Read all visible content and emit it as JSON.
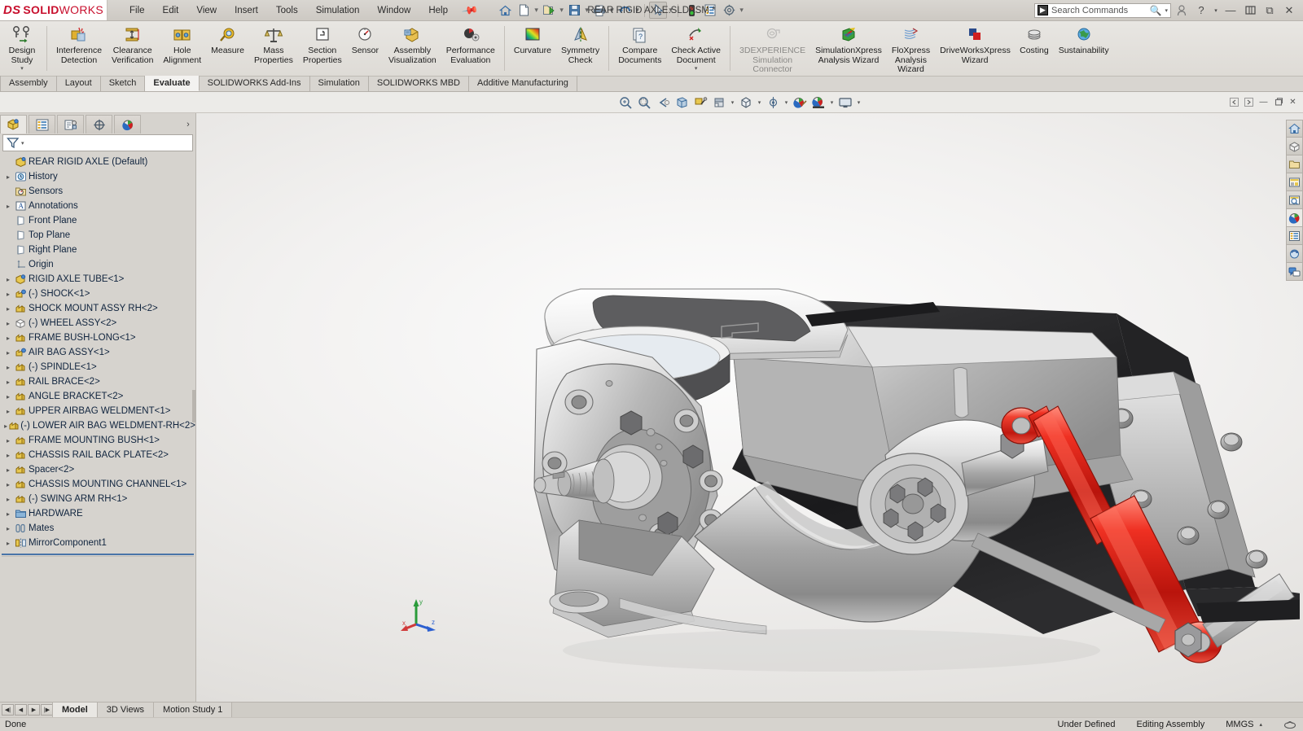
{
  "app": {
    "brand_ds": "DS",
    "brand_solid": "SOLID",
    "brand_works": "WORKS",
    "document_title": "REAR RIGID AXLE.SLDASM *"
  },
  "menubar": {
    "items": [
      {
        "label": "File"
      },
      {
        "label": "Edit"
      },
      {
        "label": "View"
      },
      {
        "label": "Insert"
      },
      {
        "label": "Tools"
      },
      {
        "label": "Simulation"
      },
      {
        "label": "Window"
      },
      {
        "label": "Help"
      }
    ],
    "pin_icon": "pushpin-icon"
  },
  "quick_access": {
    "buttons": [
      {
        "name": "home-icon",
        "glyph": "⌂"
      },
      {
        "name": "new-document-icon",
        "glyph": "□"
      },
      {
        "name": "open-document-icon",
        "glyph": "▶"
      },
      {
        "name": "save-icon",
        "glyph": "▤"
      },
      {
        "name": "print-icon",
        "glyph": "⎙"
      },
      {
        "name": "undo-icon",
        "glyph": "↶"
      },
      {
        "name": "select-cursor-icon",
        "glyph": "➤"
      },
      {
        "name": "rebuild-traffic-light-icon",
        "glyph": "●"
      },
      {
        "name": "options-list-icon",
        "glyph": "☰"
      },
      {
        "name": "settings-gear-icon",
        "glyph": "⚙"
      }
    ]
  },
  "search": {
    "placeholder": "Search Commands",
    "logo_glyph": "▶",
    "magnifier_icon": "search-icon"
  },
  "window_controls": {
    "account_icon": "user-account-icon",
    "help_icon": "help-question-icon",
    "minimize": "—",
    "restore": "⧉",
    "close": "✕"
  },
  "ribbon": {
    "groups": [
      {
        "buttons": [
          {
            "label": "Design\nStudy",
            "name": "design-study-button",
            "icon": "design-study-icon",
            "caret": true,
            "disabled": false
          }
        ]
      },
      {
        "buttons": [
          {
            "label": "Interference\nDetection",
            "name": "interference-detection-button",
            "icon": "interference-detection-icon",
            "caret": false,
            "disabled": false
          },
          {
            "label": "Clearance\nVerification",
            "name": "clearance-verification-button",
            "icon": "clearance-verification-icon",
            "caret": false,
            "disabled": false
          },
          {
            "label": "Hole\nAlignment",
            "name": "hole-alignment-button",
            "icon": "hole-alignment-icon",
            "caret": false,
            "disabled": false
          },
          {
            "label": "Measure",
            "name": "measure-button",
            "icon": "measure-tape-icon",
            "caret": false,
            "disabled": false
          },
          {
            "label": "Mass\nProperties",
            "name": "mass-properties-button",
            "icon": "mass-properties-scale-icon",
            "caret": false,
            "disabled": false
          },
          {
            "label": "Section\nProperties",
            "name": "section-properties-button",
            "icon": "section-properties-icon",
            "caret": false,
            "disabled": false
          },
          {
            "label": "Sensor",
            "name": "sensor-button",
            "icon": "sensor-gauge-icon",
            "caret": false,
            "disabled": false
          },
          {
            "label": "Assembly\nVisualization",
            "name": "assembly-visualization-button",
            "icon": "assembly-visualization-icon",
            "caret": false,
            "disabled": false
          },
          {
            "label": "Performance\nEvaluation",
            "name": "performance-evaluation-button",
            "icon": "performance-evaluation-icon",
            "caret": false,
            "disabled": false
          }
        ]
      },
      {
        "buttons": [
          {
            "label": "Curvature",
            "name": "curvature-button",
            "icon": "curvature-rainbow-icon",
            "caret": false,
            "disabled": false
          },
          {
            "label": "Symmetry\nCheck",
            "name": "symmetry-check-button",
            "icon": "symmetry-check-icon",
            "caret": false,
            "disabled": false
          }
        ]
      },
      {
        "buttons": [
          {
            "label": "Compare\nDocuments",
            "name": "compare-documents-button",
            "icon": "compare-documents-icon",
            "caret": false,
            "disabled": false
          },
          {
            "label": "Check Active\nDocument",
            "name": "check-active-document-button",
            "icon": "check-active-document-icon",
            "caret": true,
            "disabled": false
          }
        ]
      },
      {
        "buttons": [
          {
            "label": "3DEXPERIENCE\nSimulation\nConnector",
            "name": "3dexperience-simulation-connector-button",
            "icon": "3dexperience-connector-icon",
            "caret": false,
            "disabled": true
          },
          {
            "label": "SimulationXpress\nAnalysis Wizard",
            "name": "simulationxpress-analysis-wizard-button",
            "icon": "simulationxpress-icon",
            "caret": false,
            "disabled": false
          },
          {
            "label": "FloXpress\nAnalysis\nWizard",
            "name": "floxpress-analysis-wizard-button",
            "icon": "floxpress-icon",
            "caret": false,
            "disabled": false
          },
          {
            "label": "DriveWorksXpress\nWizard",
            "name": "driveworksxpress-wizard-button",
            "icon": "driveworksxpress-icon",
            "caret": false,
            "disabled": false
          },
          {
            "label": "Costing",
            "name": "costing-button",
            "icon": "costing-coins-icon",
            "caret": false,
            "disabled": false
          },
          {
            "label": "Sustainability",
            "name": "sustainability-button",
            "icon": "sustainability-globe-icon",
            "caret": false,
            "disabled": false
          }
        ]
      }
    ]
  },
  "command_tabs": {
    "items": [
      {
        "label": "Assembly",
        "active": false
      },
      {
        "label": "Layout",
        "active": false
      },
      {
        "label": "Sketch",
        "active": false
      },
      {
        "label": "Evaluate",
        "active": true
      },
      {
        "label": "SOLIDWORKS Add-Ins",
        "active": false
      },
      {
        "label": "Simulation",
        "active": false
      },
      {
        "label": "SOLIDWORKS MBD",
        "active": false
      },
      {
        "label": "Additive Manufacturing",
        "active": false
      }
    ]
  },
  "view_toolbar": {
    "buttons": [
      {
        "name": "zoom-to-fit-icon",
        "caret": false
      },
      {
        "name": "zoom-to-area-icon",
        "caret": false
      },
      {
        "name": "previous-view-icon",
        "caret": false
      },
      {
        "name": "section-view-icon",
        "caret": false
      },
      {
        "name": "view-orientation-paint-icon",
        "caret": false
      },
      {
        "name": "view-orientation-icon",
        "caret": true
      },
      {
        "name": "display-style-icon",
        "caret": true
      },
      {
        "name": "hide-show-items-icon",
        "caret": true
      },
      {
        "name": "edit-appearance-icon",
        "caret": false
      },
      {
        "name": "apply-scene-icon",
        "caret": true
      },
      {
        "name": "view-settings-icon",
        "caret": true
      }
    ],
    "panel_controls": [
      {
        "name": "collapse-left-icon",
        "glyph": "◀"
      },
      {
        "name": "expand-right-icon",
        "glyph": "▶"
      },
      {
        "name": "minimize-document-icon",
        "glyph": "—"
      },
      {
        "name": "restore-document-icon",
        "glyph": "⧉"
      },
      {
        "name": "close-document-icon",
        "glyph": "✕"
      }
    ]
  },
  "feature_tree": {
    "tabs": [
      {
        "name": "feature-manager-tab",
        "icon": "assembly-tree-icon",
        "active": true
      },
      {
        "name": "property-manager-tab",
        "icon": "property-list-icon",
        "active": false
      },
      {
        "name": "configuration-manager-tab",
        "icon": "configuration-icon",
        "active": false
      },
      {
        "name": "dimxpert-manager-tab",
        "icon": "dimxpert-target-icon",
        "active": false
      },
      {
        "name": "display-manager-tab",
        "icon": "display-manager-sphere-icon",
        "active": false
      }
    ],
    "expand_arrow": "›",
    "filter_icon": "filter-funnel-icon",
    "root": {
      "label": "REAR RIGID AXLE  (Default)",
      "icon": "assembly-icon"
    },
    "items": [
      {
        "label": "History",
        "icon": "history-clock-icon",
        "expandable": true,
        "indent": 1
      },
      {
        "label": "Sensors",
        "icon": "sensors-folder-icon",
        "expandable": false,
        "indent": 1
      },
      {
        "label": "Annotations",
        "icon": "annotations-icon",
        "expandable": true,
        "indent": 1
      },
      {
        "label": "Front Plane",
        "icon": "plane-icon",
        "expandable": false,
        "indent": 1
      },
      {
        "label": "Top Plane",
        "icon": "plane-icon",
        "expandable": false,
        "indent": 1
      },
      {
        "label": "Right Plane",
        "icon": "plane-icon",
        "expandable": false,
        "indent": 1
      },
      {
        "label": "Origin",
        "icon": "origin-icon",
        "expandable": false,
        "indent": 1
      },
      {
        "label": "RIGID AXLE TUBE<1>",
        "icon": "part-fixed-icon",
        "expandable": true,
        "indent": 1
      },
      {
        "label": "(-) SHOCK<1>",
        "icon": "subassembly-icon",
        "expandable": true,
        "indent": 1
      },
      {
        "label": "SHOCK MOUNT ASSY RH<2>",
        "icon": "part-icon",
        "expandable": true,
        "indent": 1
      },
      {
        "label": "(-) WHEEL ASSY<2>",
        "icon": "part-lightweight-icon",
        "expandable": true,
        "indent": 1
      },
      {
        "label": "FRAME BUSH-LONG<1>",
        "icon": "part-icon",
        "expandable": true,
        "indent": 1
      },
      {
        "label": "AIR BAG ASSY<1>",
        "icon": "subassembly-icon",
        "expandable": true,
        "indent": 1
      },
      {
        "label": "(-) SPINDLE<1>",
        "icon": "part-icon",
        "expandable": true,
        "indent": 1
      },
      {
        "label": "RAIL BRACE<2>",
        "icon": "part-icon",
        "expandable": true,
        "indent": 1
      },
      {
        "label": "ANGLE BRACKET<2>",
        "icon": "part-icon",
        "expandable": true,
        "indent": 1
      },
      {
        "label": "UPPER AIRBAG WELDMENT<1>",
        "icon": "part-icon",
        "expandable": true,
        "indent": 1
      },
      {
        "label": "(-) LOWER AIR BAG WELDMENT-RH<2>",
        "icon": "part-icon",
        "expandable": true,
        "indent": 1
      },
      {
        "label": "FRAME MOUNTING BUSH<1>",
        "icon": "part-icon",
        "expandable": true,
        "indent": 1
      },
      {
        "label": "CHASSIS RAIL BACK PLATE<2>",
        "icon": "part-icon",
        "expandable": true,
        "indent": 1
      },
      {
        "label": "Spacer<2>",
        "icon": "part-icon",
        "expandable": true,
        "indent": 1
      },
      {
        "label": "CHASSIS MOUNTING CHANNEL<1>",
        "icon": "part-icon",
        "expandable": true,
        "indent": 1
      },
      {
        "label": "(-) SWING ARM RH<1>",
        "icon": "part-icon",
        "expandable": true,
        "indent": 1
      },
      {
        "label": "HARDWARE",
        "icon": "folder-icon",
        "expandable": true,
        "indent": 1
      },
      {
        "label": "Mates",
        "icon": "mates-icon",
        "expandable": true,
        "indent": 1
      },
      {
        "label": "MirrorComponent1",
        "icon": "mirror-component-icon",
        "expandable": true,
        "indent": 1
      }
    ]
  },
  "right_dock": {
    "buttons": [
      {
        "name": "view-palette-home-icon"
      },
      {
        "name": "appearances-scenes-icon"
      },
      {
        "name": "design-library-icon"
      },
      {
        "name": "file-explorer-icon"
      },
      {
        "name": "search-library-icon"
      },
      {
        "name": "appearances-sphere-icon",
        "active": true
      },
      {
        "name": "custom-properties-icon"
      },
      {
        "name": "3d-views-refresh-icon"
      },
      {
        "name": "collaboration-chat-icon"
      }
    ]
  },
  "bottom_tabs": {
    "nav": [
      {
        "name": "first-tab-button",
        "glyph": "⏮"
      },
      {
        "name": "previous-tab-button",
        "glyph": "◀"
      },
      {
        "name": "next-tab-button",
        "glyph": "▶"
      },
      {
        "name": "last-tab-button",
        "glyph": "⏭"
      }
    ],
    "tabs": [
      {
        "label": "Model",
        "active": true
      },
      {
        "label": "3D Views",
        "active": false
      },
      {
        "label": "Motion Study 1",
        "active": false
      }
    ]
  },
  "status_bar": {
    "message": "Done",
    "sketch_state": "Under Defined",
    "edit_mode": "Editing Assembly",
    "units": "MMGS",
    "units_caret": "▴",
    "overlay_icon": "overlay-stamp-icon"
  },
  "triad": {
    "x_label": "x",
    "y_label": "y",
    "z_label": "z",
    "x_color": "#d03a3a",
    "y_color": "#2a9b3a",
    "z_color": "#2b5fd0"
  },
  "colors": {
    "brand_red": "#c8102e",
    "accent_blue": "#2b7dc0",
    "chrome": "#d6d3ce",
    "ribbon": "#e8e6e2"
  }
}
